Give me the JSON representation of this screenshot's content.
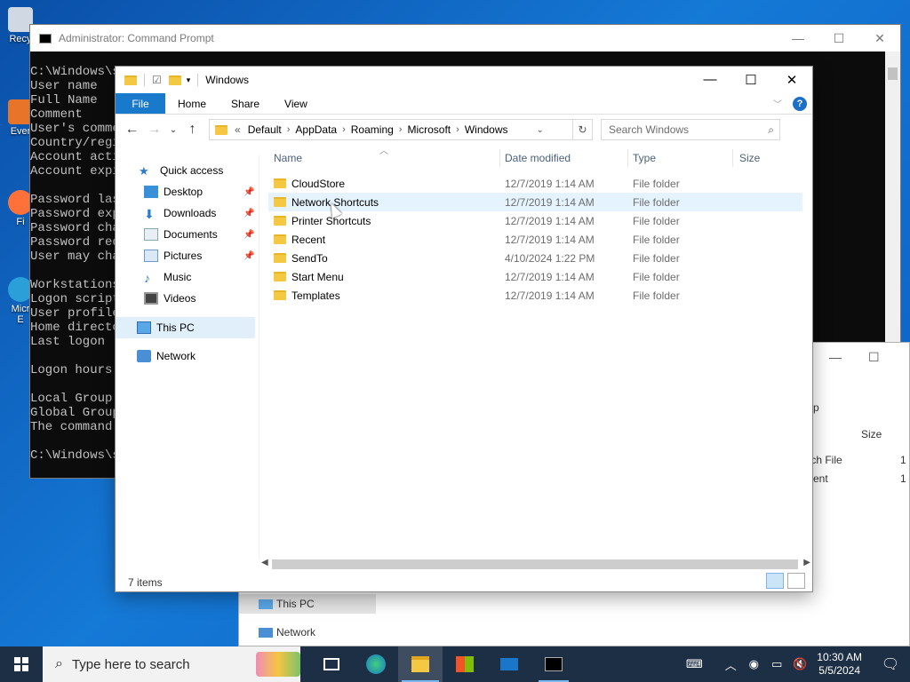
{
  "desktop": {
    "icons": [
      {
        "label": "Recy",
        "icon": "recycle-bin-icon"
      },
      {
        "label": "Ever",
        "icon": "app-icon"
      },
      {
        "label": "Fi",
        "icon": "firefox-icon"
      },
      {
        "label": "Micr E",
        "icon": "edge-icon"
      }
    ]
  },
  "cmd": {
    "title": "Administrator: Command Prompt",
    "lines": "C:\\Windows\\s\nUser name\nFull Name\nComment\nUser's comme\nCountry/regi\nAccount acti\nAccount expi\n\nPassword las\nPassword exp\nPassword cha\nPassword req\nUser may cha\n\nWorkstations\nLogon script\nUser profile\nHome directo\nLast logon\n\nLogon hours\n\nLocal Group\nGlobal Group\nThe command\n\nC:\\Windows\\s"
  },
  "bgwin": {
    "col_fragment": "p",
    "size_header": "Size",
    "row1_type": "tch File",
    "row2_type": "ent",
    "row1_size": "1 ",
    "row2_size": "1 ",
    "nav_this_pc": "This PC",
    "nav_network": "Network"
  },
  "explorer": {
    "title": "Windows",
    "ribbon_tabs": {
      "file": "File",
      "home": "Home",
      "share": "Share",
      "view": "View"
    },
    "address": {
      "overflow": "«",
      "crumbs": [
        "Default",
        "AppData",
        "Roaming",
        "Microsoft",
        "Windows"
      ]
    },
    "search_placeholder": "Search Windows",
    "nav": {
      "quick_access": "Quick access",
      "desktop": "Desktop",
      "downloads": "Downloads",
      "documents": "Documents",
      "pictures": "Pictures",
      "music": "Music",
      "videos": "Videos",
      "this_pc": "This PC",
      "network": "Network"
    },
    "columns": {
      "name": "Name",
      "date": "Date modified",
      "type": "Type",
      "size": "Size"
    },
    "files": [
      {
        "name": "CloudStore",
        "date": "12/7/2019 1:14 AM",
        "type": "File folder"
      },
      {
        "name": "Network Shortcuts",
        "date": "12/7/2019 1:14 AM",
        "type": "File folder"
      },
      {
        "name": "Printer Shortcuts",
        "date": "12/7/2019 1:14 AM",
        "type": "File folder"
      },
      {
        "name": "Recent",
        "date": "12/7/2019 1:14 AM",
        "type": "File folder"
      },
      {
        "name": "SendTo",
        "date": "4/10/2024 1:22 PM",
        "type": "File folder"
      },
      {
        "name": "Start Menu",
        "date": "12/7/2019 1:14 AM",
        "type": "File folder"
      },
      {
        "name": "Templates",
        "date": "12/7/2019 1:14 AM",
        "type": "File folder"
      }
    ],
    "status": "7 items"
  },
  "taskbar": {
    "search_placeholder": "Type here to search",
    "time": "10:30 AM",
    "date": "5/5/2024"
  },
  "colors": {
    "accent": "#1979ca",
    "taskbar": "#1d2f45",
    "hover_row": "#e5f3ff",
    "folder": "#f4c842"
  }
}
